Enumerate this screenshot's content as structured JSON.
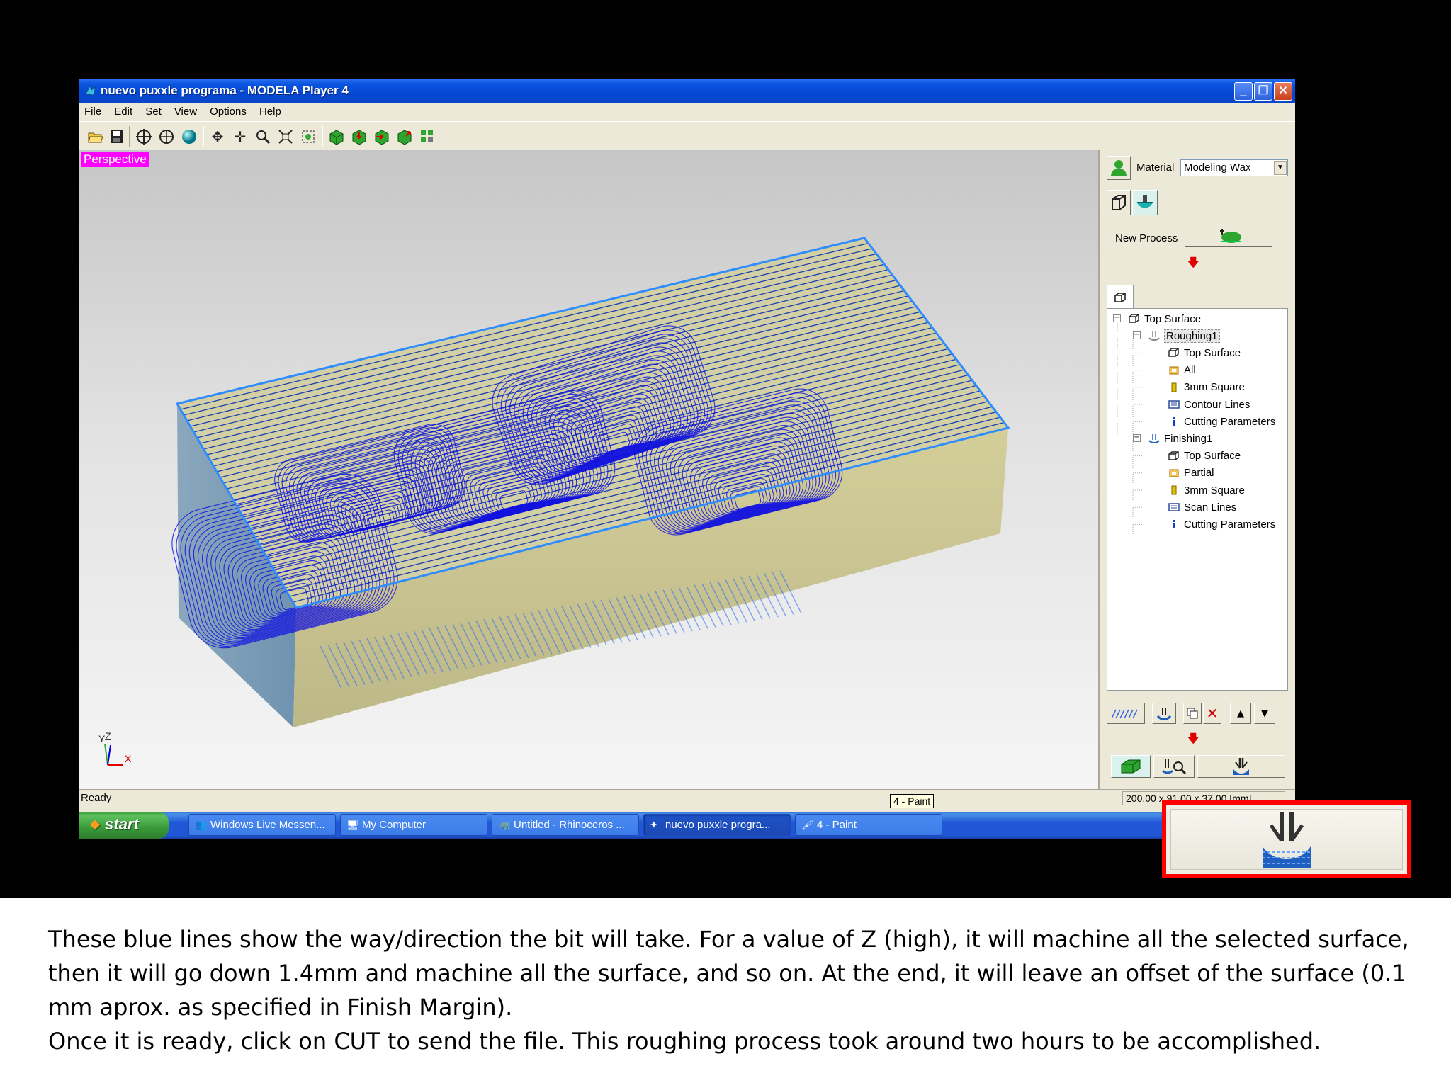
{
  "window": {
    "title": "nuevo puxxle programa - MODELA Player 4",
    "minimize": "_",
    "restore": "❐",
    "close": "✕"
  },
  "menu": [
    "File",
    "Edit",
    "Set",
    "View",
    "Options",
    "Help"
  ],
  "toolbar_icons": [
    "open-icon",
    "save-icon",
    "crosshair-icon",
    "rotate-view-icon",
    "render-sphere-icon",
    "pan-icon",
    "move-icon",
    "zoom-icon",
    "fit-view-icon",
    "zoom-window-icon",
    "box-top-icon",
    "box-front-icon",
    "box-side-icon",
    "box-iso-icon",
    "grid-view-icon"
  ],
  "viewport": {
    "label": "Perspective",
    "axis_y": "Y",
    "axis_z": "Z",
    "axis_x": "X"
  },
  "panel": {
    "material_label": "Material",
    "material_value": "Modeling Wax",
    "new_process_label": "New Process"
  },
  "tree": [
    {
      "label": "Top Surface",
      "level": 0,
      "icon": "box-icon",
      "expander": "−"
    },
    {
      "label": "Roughing1",
      "level": 1,
      "icon": "roughing-icon",
      "expander": "−",
      "selected": true
    },
    {
      "label": "Top Surface",
      "level": 2,
      "icon": "box-icon"
    },
    {
      "label": "All",
      "level": 2,
      "icon": "area-icon"
    },
    {
      "label": "3mm Square",
      "level": 2,
      "icon": "tool-icon"
    },
    {
      "label": "Contour Lines",
      "level": 2,
      "icon": "path-icon"
    },
    {
      "label": "Cutting Parameters",
      "level": 2,
      "icon": "info-icon"
    },
    {
      "label": "Finishing1",
      "level": 1,
      "icon": "finishing-icon",
      "expander": "−"
    },
    {
      "label": "Top Surface",
      "level": 2,
      "icon": "box-icon"
    },
    {
      "label": "Partial",
      "level": 2,
      "icon": "area-icon"
    },
    {
      "label": "3mm Square",
      "level": 2,
      "icon": "tool-icon"
    },
    {
      "label": "Scan Lines",
      "level": 2,
      "icon": "path-icon"
    },
    {
      "label": "Cutting Parameters",
      "level": 2,
      "icon": "info-icon"
    }
  ],
  "status": {
    "text": "Ready",
    "dims": "200.00 x 91.00 x 37.00 [mm]"
  },
  "tooltip": "4 - Paint",
  "taskbar": {
    "start": "start",
    "tasks": [
      {
        "label": "Windows Live Messen...",
        "icon": "messenger-icon"
      },
      {
        "label": "My Computer",
        "icon": "computer-icon"
      },
      {
        "label": "Untitled - Rhinoceros ...",
        "icon": "rhino-icon"
      },
      {
        "label": "nuevo puxxle progra...",
        "icon": "modela-icon",
        "active": true
      },
      {
        "label": "4 - Paint",
        "icon": "paint-icon"
      }
    ]
  },
  "colors": {
    "toolpath": "#1010e0",
    "model_top_edge": "#3399ff",
    "model_side": "#c9c48e",
    "callout_border": "#ff0000",
    "perspective_label": "#ff00ff"
  },
  "caption": {
    "line1": "These blue lines show the way/direction the bit will take. For a value of Z (high), it will machine all the selected surface, then it will go down 1.4mm and machine all the surface, and so on. At the end, it will leave an offset of the surface  (0.1 mm aprox. as specified in Finish Margin).",
    "line2": "Once it is ready, click on CUT to send the file. This roughing process took around two hours to be accomplished."
  }
}
